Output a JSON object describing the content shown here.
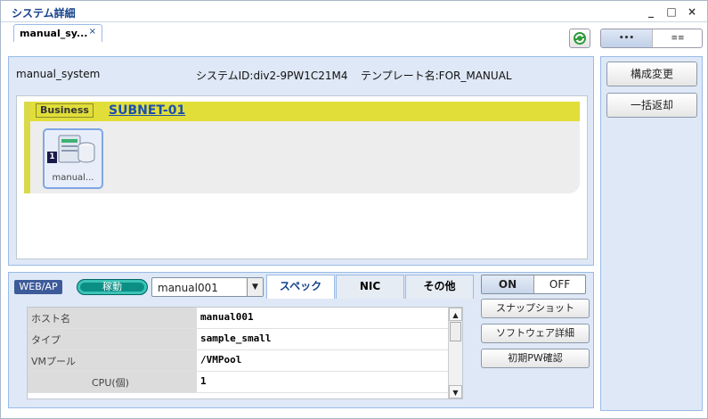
{
  "window": {
    "title": "システム詳細",
    "controls": {
      "minimize": "_",
      "maximize": "□",
      "close": "×"
    }
  },
  "tabs": [
    {
      "label": "manual_sy...",
      "close": "×"
    }
  ],
  "toolbar": {
    "view_options": [
      "•••",
      "≡≡"
    ]
  },
  "system": {
    "name": "manual_system",
    "id_text": "システムID:div2-9PW1C21M4",
    "template_text": "テンプレート名:FOR_MANUAL"
  },
  "network": {
    "segment_label": "Business",
    "subnet_name": "SUBNET-01",
    "node": {
      "count": "1",
      "label": "manual..."
    }
  },
  "detail": {
    "role_badge": "WEB/AP",
    "status": "稼動",
    "host_select": "manual001",
    "tabs": [
      "スペック",
      "NIC",
      "その他"
    ],
    "active_tab": "スペック",
    "rows": [
      {
        "key": "ホスト名",
        "value": "manual001"
      },
      {
        "key": "タイプ",
        "value": "sample_small"
      },
      {
        "key": "VMプール",
        "value": "/VMPool"
      },
      {
        "key": "CPU(個)",
        "value": "1"
      }
    ],
    "power": {
      "on": "ON",
      "off": "OFF"
    },
    "actions": [
      "スナップショット",
      "ソフトウェア詳細",
      "初期PW確認"
    ]
  },
  "side_actions": [
    "構成変更",
    "一括返却"
  ],
  "colors": {
    "accent": "#15428b",
    "subnet_bar": "#e1de3a",
    "status": "#0b8e84",
    "panel": "#dfe8f6"
  }
}
